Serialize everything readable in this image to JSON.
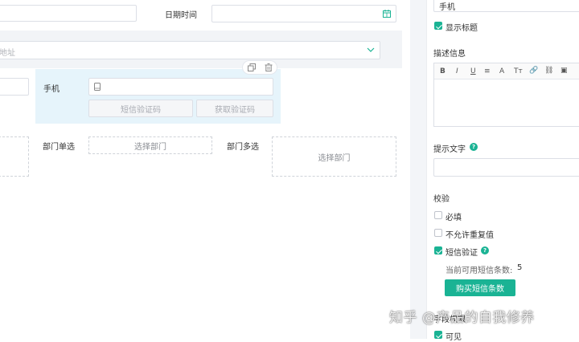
{
  "form": {
    "date_label": "日期时间",
    "address_placeholder": "地址",
    "phone_label": "手机",
    "sms_code_placeholder": "短信验证码",
    "get_code_button": "获取验证码",
    "dept_single_label": "部门单选",
    "dept_single_button": "选择部门",
    "dept_multi_label": "部门多选",
    "dept_multi_button": "选择部门"
  },
  "panel": {
    "title_value": "手机",
    "show_title_label": "显示标题",
    "desc_heading": "描述信息",
    "toolbar": [
      "B",
      "I",
      "U",
      "≡",
      "A",
      "Tт",
      "🔗",
      "⛓",
      "▣"
    ],
    "hint_heading": "提示文字",
    "validation_heading": "校验",
    "required_label": "必填",
    "no_duplicate_label": "不允许重复值",
    "sms_verify_label": "短信验证",
    "sms_count_label": "当前可用短信条数:",
    "sms_count_value": "5",
    "buy_sms_button": "购买短信条数",
    "field_permission_heading": "字段权限",
    "visible_label": "可见"
  },
  "watermark": "知乎 @产品的自我修养",
  "colors": {
    "accent": "#1ab394",
    "selected_field_bg": "#e6f4fb"
  }
}
